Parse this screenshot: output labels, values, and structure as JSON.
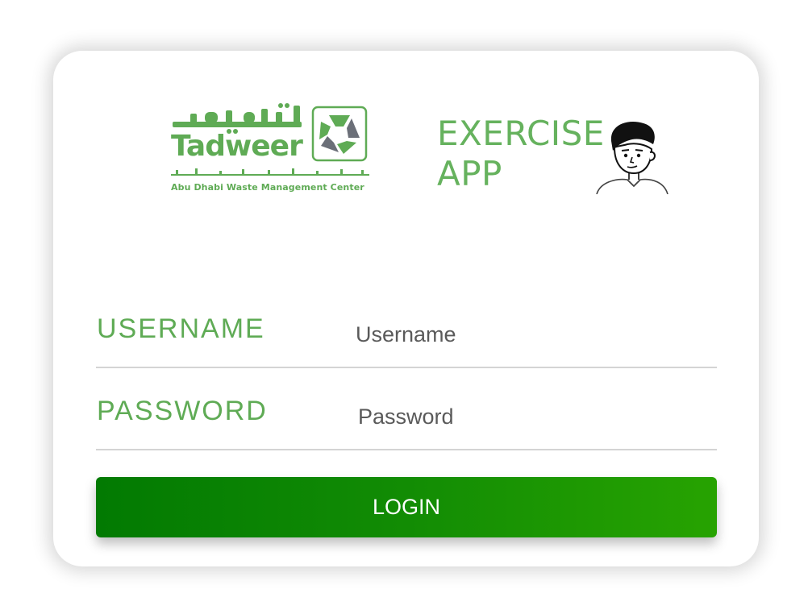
{
  "logos": {
    "tadweer": {
      "brand": "Tadweer",
      "subtitle": "Abu Dhabi Waste Management Center",
      "color": "#5fab55",
      "icon": "recycle-arrows-icon"
    },
    "exercise_app": {
      "line1": "EXERCISE",
      "line2": "APP",
      "color": "#66b25e",
      "icon": "person-illustration-icon"
    }
  },
  "form": {
    "username_label": "USERNAME",
    "username_placeholder": "Username",
    "username_value": "",
    "password_label": "PASSWORD",
    "password_placeholder": "Password",
    "password_value": "",
    "login_label": "LOGIN"
  },
  "colors": {
    "label_green": "#5fab55",
    "button_gradient_start": "#027a02",
    "button_gradient_end": "#27a301",
    "divider": "#d4d4d4"
  }
}
